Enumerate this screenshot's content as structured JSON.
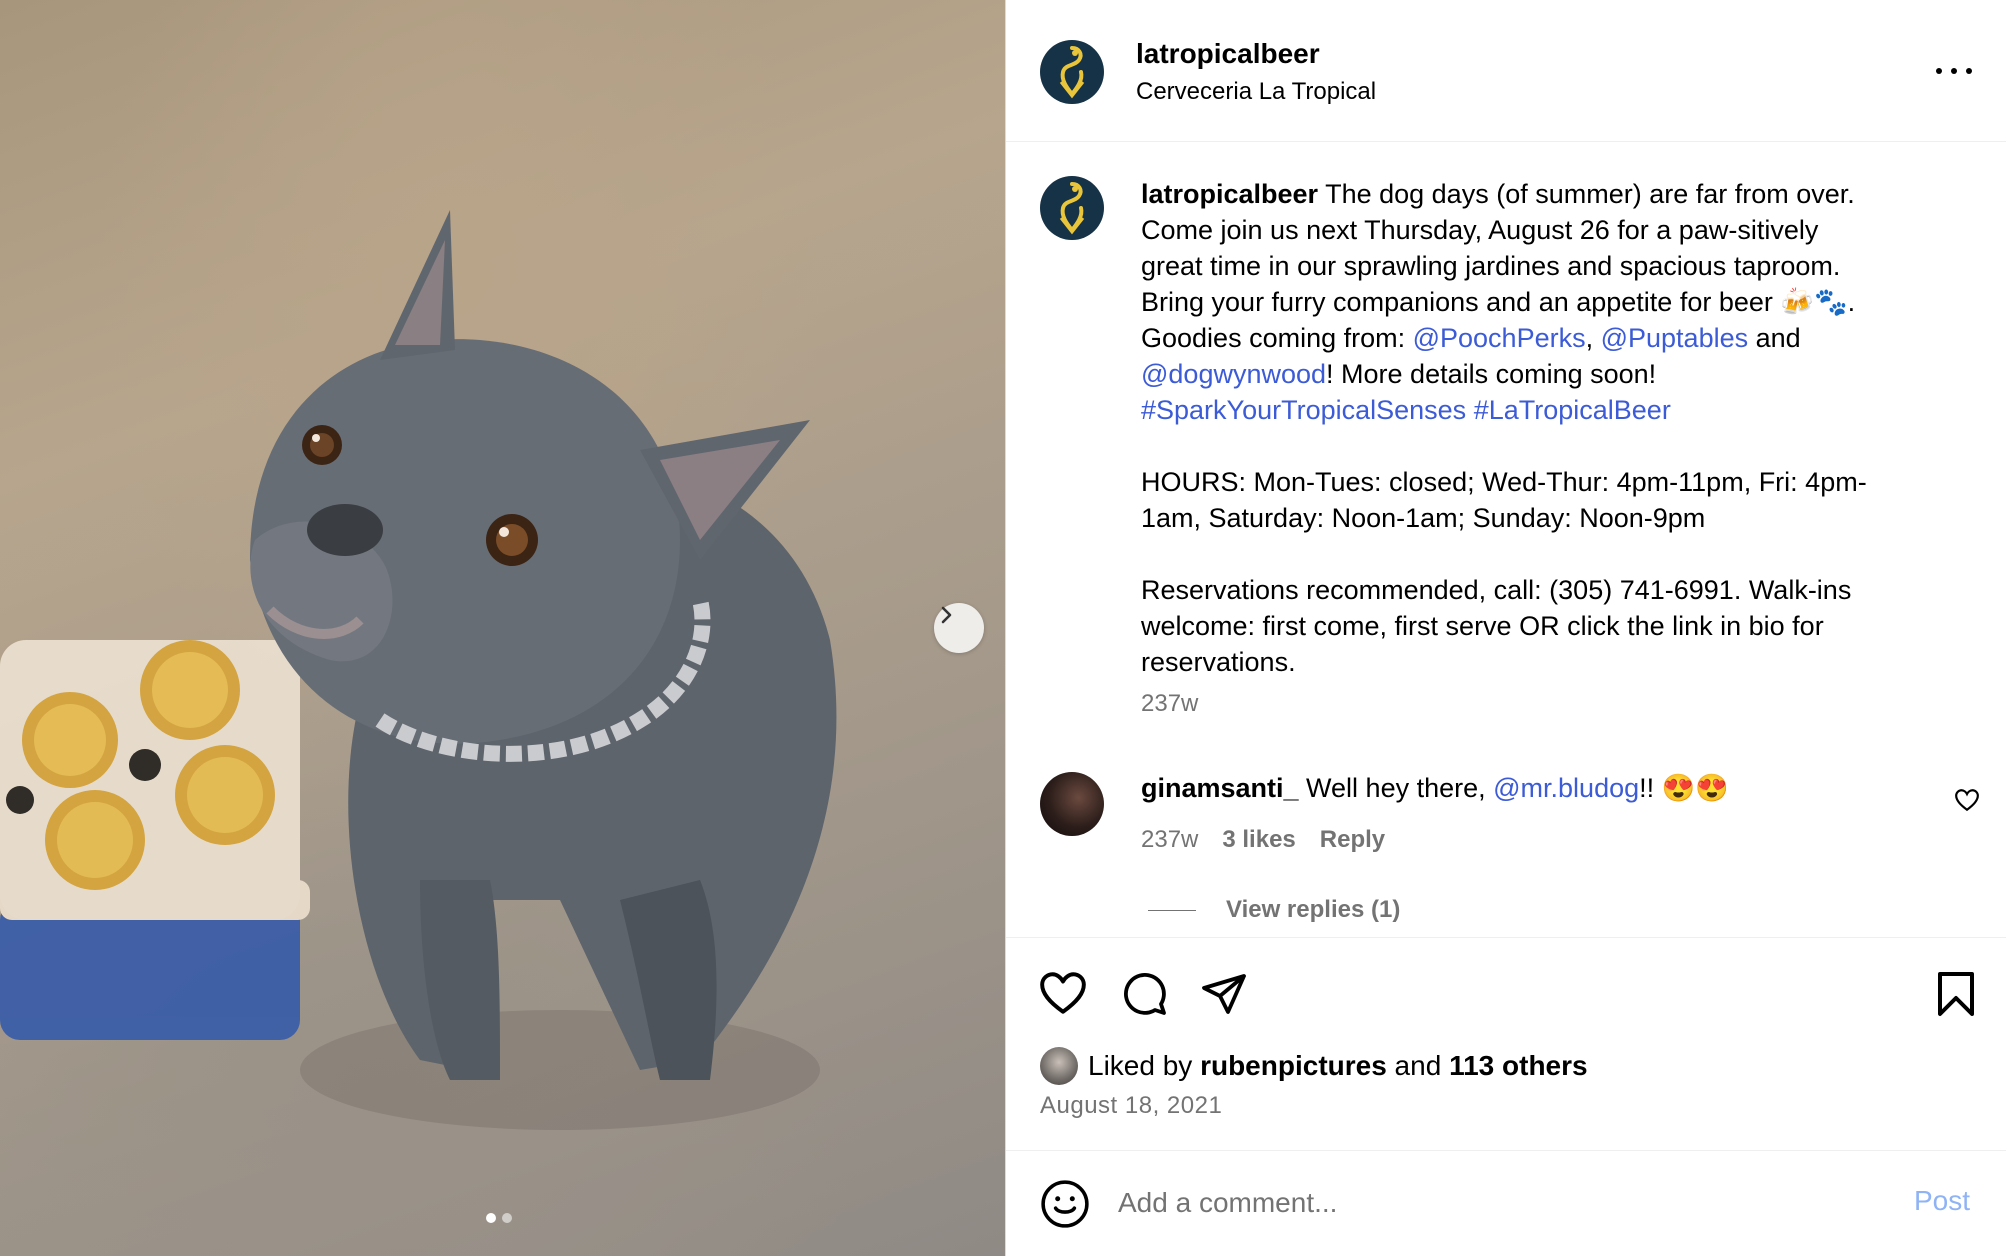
{
  "post": {
    "username": "latropicalbeer",
    "location": "Cerveceria La Tropical",
    "caption": {
      "line1_text": " The dog days (of summer) are far from over.",
      "line2": "Come join us next Thursday, August 26 for a paw-sitively",
      "line3": "great time in our sprawling jardines and spacious taproom.",
      "line4": "Bring your furry companions and an appetite for beer 🍻🐾.",
      "goodies_prefix": "Goodies coming from: ",
      "mention1": "@PoochPerks",
      "comma": ", ",
      "mention2": "@Puptables",
      "and": " and",
      "mention3": "@dogwynwood",
      "details": "! More details coming soon!",
      "hashtag1": "#SparkYourTropicalSenses",
      "hashtag2": "#LaTropicalBeer",
      "hours_line1": "HOURS: Mon-Tues: closed; Wed-Thur: 4pm-11pm, Fri: 4pm-",
      "hours_line2": "1am, Saturday: Noon-1am; Sunday: Noon-9pm",
      "res_line1": "Reservations recommended, call: (305) 741-6991. Walk-ins",
      "res_line2": "welcome: first come, first serve OR click the link in bio for",
      "res_line3": "reservations."
    },
    "caption_time": "237w",
    "comment": {
      "username": "ginamsanti_",
      "text_prefix": " Well hey there, ",
      "mention": "@mr.bludog",
      "text_suffix": "!! 😍😍",
      "time": "237w",
      "likes": "3 likes",
      "reply": "Reply",
      "view_replies": "View replies (1)"
    },
    "likes": {
      "prefix": "Liked by ",
      "user": "rubenpictures",
      "and": " and ",
      "others": "113 others"
    },
    "date": "August 18, 2021",
    "add_comment_placeholder": "Add a comment...",
    "post_label": "Post"
  },
  "colors": {
    "link": "#3c5bd6",
    "secondary_text": "#737373",
    "post_button": "#8fb3f5",
    "avatar_bg": "#163246",
    "logo_yellow": "#e8c53a"
  },
  "icons": [
    "chevron-right-icon",
    "more-icon",
    "heart-icon",
    "comment-icon",
    "share-icon",
    "bookmark-icon",
    "emoji-icon"
  ],
  "carousel": {
    "current": 1,
    "total": 2
  }
}
